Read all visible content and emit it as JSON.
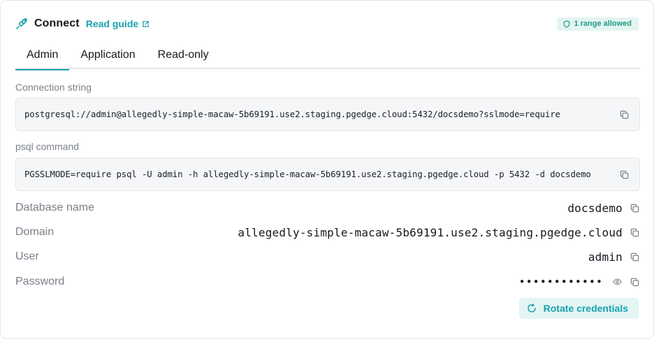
{
  "header": {
    "icon": "plug-icon",
    "title": "Connect",
    "guide_link": "Read guide",
    "guide_icon": "external-link-icon",
    "badge": "1 range allowed",
    "badge_icon": "shield-icon"
  },
  "tabs": [
    {
      "label": "Admin",
      "active": true
    },
    {
      "label": "Application",
      "active": false
    },
    {
      "label": "Read-only",
      "active": false
    }
  ],
  "connection_string": {
    "label": "Connection string",
    "value": "postgresql://admin@allegedly-simple-macaw-5b69191.use2.staging.pgedge.cloud:5432/docsdemo?sslmode=require"
  },
  "psql_command": {
    "label": "psql command",
    "value": "PGSSLMODE=require psql -U admin -h allegedly-simple-macaw-5b69191.use2.staging.pgedge.cloud -p 5432 -d docsdemo"
  },
  "details": {
    "database_name": {
      "label": "Database name",
      "value": "docsdemo"
    },
    "domain": {
      "label": "Domain",
      "value": "allegedly-simple-macaw-5b69191.use2.staging.pgedge.cloud"
    },
    "user": {
      "label": "User",
      "value": "admin"
    },
    "password": {
      "label": "Password",
      "value": "••••••••••••"
    }
  },
  "rotate_button": {
    "label": "Rotate credentials",
    "icon": "refresh-icon"
  },
  "colors": {
    "accent": "#17a2ad",
    "badge_bg": "#e3f5f0",
    "badge_text": "#1f9a84",
    "muted": "#7a808a"
  }
}
